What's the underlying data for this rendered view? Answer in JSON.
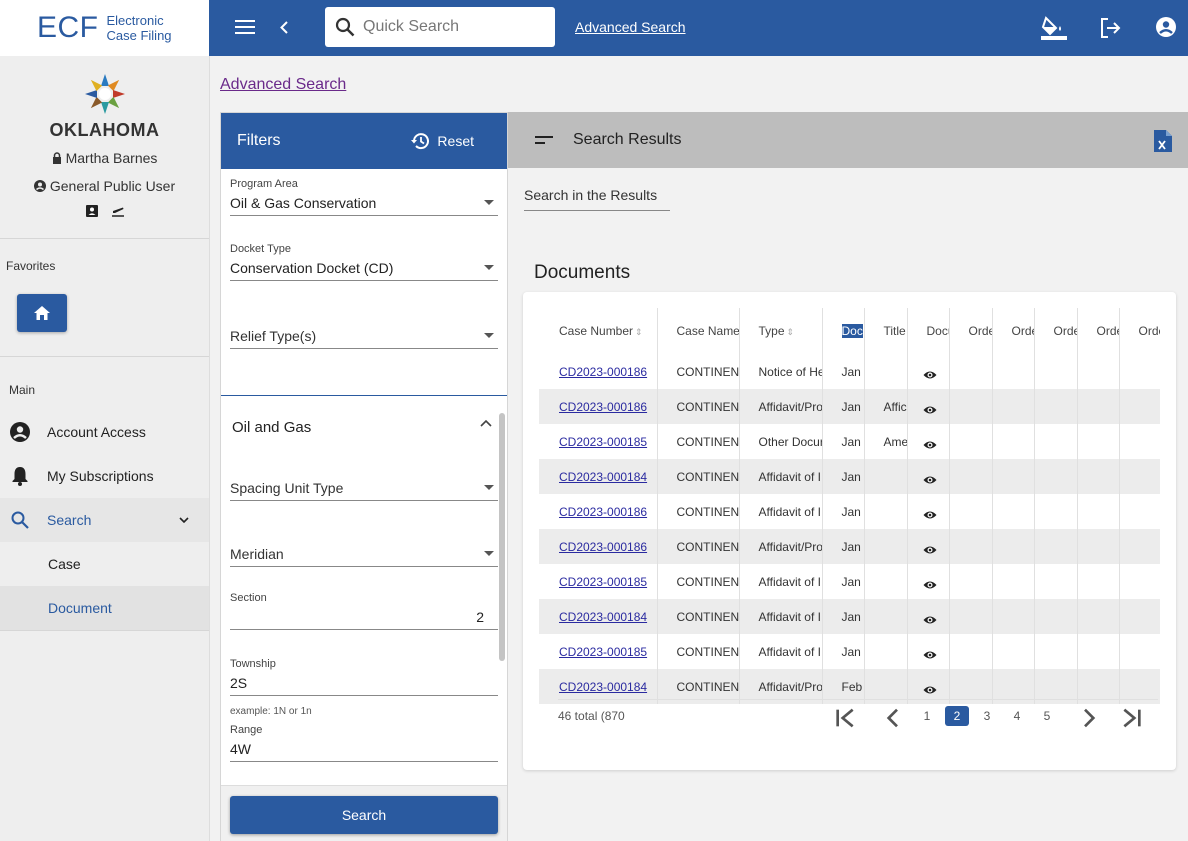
{
  "logo": {
    "brand": "ECF",
    "line1": "Electronic",
    "line2": "Case Filing",
    "state": "OKLAHOMA"
  },
  "user": {
    "name": "Martha Barnes",
    "role": "General Public User"
  },
  "sidebar": {
    "favorites_title": "Favorites",
    "main_title": "Main",
    "items": [
      {
        "label": "Account Access"
      },
      {
        "label": "My Subscriptions"
      },
      {
        "label": "Search"
      }
    ],
    "sub_items": [
      {
        "label": "Case"
      },
      {
        "label": "Document"
      }
    ]
  },
  "topbar": {
    "search_placeholder": "Quick Search",
    "advanced_link": "Advanced Search"
  },
  "page": {
    "link": "Advanced Search"
  },
  "filters": {
    "title": "Filters",
    "reset": "Reset",
    "program_area": {
      "label": "Program Area",
      "value": "Oil & Gas Conservation"
    },
    "docket_type": {
      "label": "Docket Type",
      "value": "Conservation Docket (CD)"
    },
    "relief_types": {
      "placeholder": "Relief Type(s)"
    },
    "section_title": "Oil and Gas",
    "spacing_unit": {
      "placeholder": "Spacing Unit Type"
    },
    "meridian": {
      "placeholder": "Meridian"
    },
    "section": {
      "label": "Section",
      "value": "2"
    },
    "township": {
      "label": "Township",
      "value": "2S",
      "hint": "example: 1N or 1n"
    },
    "range": {
      "label": "Range",
      "value": "4W"
    },
    "search_button": "Search"
  },
  "results": {
    "title": "Search Results",
    "search_in": "Search in the Results",
    "documents_title": "Documents",
    "columns": [
      "Case Number",
      "Case Name",
      "Type",
      "Doc",
      "Title",
      "Docu",
      "Orde",
      "Orde",
      "Orde",
      "Orde",
      "Orde"
    ],
    "rows": [
      {
        "case": "CD2023-000186",
        "name": "CONTINENT",
        "type": "Notice of He",
        "date": "Jan",
        "title": ""
      },
      {
        "case": "CD2023-000186",
        "name": "CONTINENT",
        "type": "Affidavit/Pro",
        "date": "Jan",
        "title": "Affic"
      },
      {
        "case": "CD2023-000185",
        "name": "CONTINENT",
        "type": "Other Docur",
        "date": "Jan",
        "title": "Ame"
      },
      {
        "case": "CD2023-000184",
        "name": "CONTINENT",
        "type": "Affidavit of I",
        "date": "Jan",
        "title": ""
      },
      {
        "case": "CD2023-000186",
        "name": "CONTINENT",
        "type": "Affidavit of I",
        "date": "Jan",
        "title": ""
      },
      {
        "case": "CD2023-000186",
        "name": "CONTINENT",
        "type": "Affidavit/Pro",
        "date": "Jan",
        "title": ""
      },
      {
        "case": "CD2023-000185",
        "name": "CONTINENT",
        "type": "Affidavit of I",
        "date": "Jan",
        "title": ""
      },
      {
        "case": "CD2023-000184",
        "name": "CONTINENT",
        "type": "Affidavit of I",
        "date": "Jan",
        "title": ""
      },
      {
        "case": "CD2023-000185",
        "name": "CONTINENT",
        "type": "Affidavit of I",
        "date": "Jan",
        "title": ""
      },
      {
        "case": "CD2023-000184",
        "name": "CONTINENT",
        "type": "Affidavit/Pro",
        "date": "Feb",
        "title": ""
      }
    ],
    "pager": {
      "total": "46 total (870",
      "pages": [
        "1",
        "2",
        "3",
        "4",
        "5"
      ],
      "current": "2"
    }
  },
  "colors": {
    "primary": "#2a5aa0",
    "header_gray": "#bdbdbd",
    "link_visited": "#6a2a8a"
  }
}
